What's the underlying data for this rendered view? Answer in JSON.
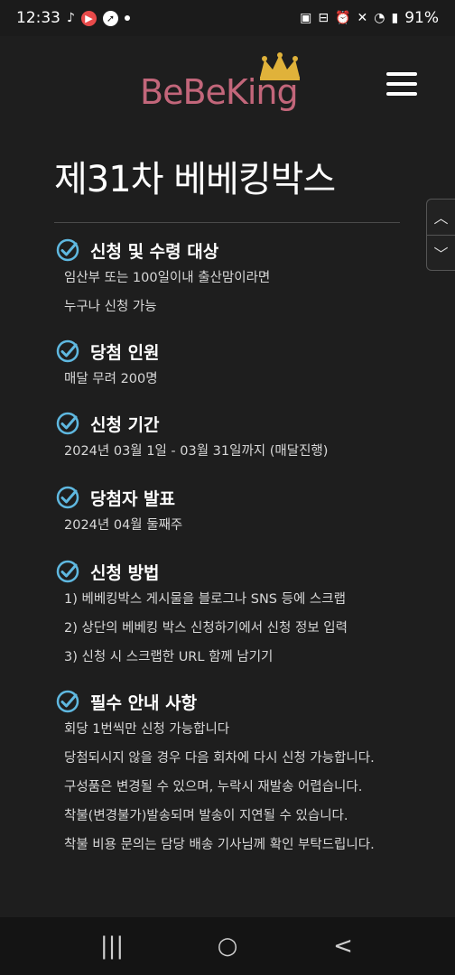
{
  "status": {
    "time": "12:33",
    "battery": "91%"
  },
  "header": {
    "logo_text": "BeBeKing"
  },
  "page": {
    "title": "제31차 베베킹박스"
  },
  "sections": [
    {
      "title": "신청 및 수령 대상",
      "lines": [
        "임산부 또는 100일이내 출산맘이라면",
        "누구나 신청 가능"
      ]
    },
    {
      "title": "당첨 인원",
      "lines": [
        "매달 무려 200명"
      ]
    },
    {
      "title": "신청 기간",
      "lines": [
        "2024년 03월 1일 - 03월 31일까지 (매달진행)"
      ]
    },
    {
      "title": "당첨자 발표",
      "lines": [
        "2024년 04월 둘째주"
      ]
    },
    {
      "title": "신청 방법",
      "lines": [
        "1) 베베킹박스 게시물을 블로그나 SNS 등에 스크랩",
        "2) 상단의 베베킹 박스 신청하기에서 신청 정보 입력",
        "3) 신청 시 스크랩한 URL 함께 남기기"
      ]
    },
    {
      "title": "필수 안내 사항",
      "lines": [
        "회당 1번씩만 신청 가능합니다",
        "당첨되시지 않을 경우 다음 회차에 다시 신청 가능합니다.",
        "구성품은 변경될 수 있으며, 누락시 재발송 어렵습니다.",
        "착불(변경불가)발송되며 발송이 지연될 수 있습니다.",
        "착불 비용 문의는 담당 배송 기사님께 확인 부탁드립니다."
      ]
    }
  ],
  "colors": {
    "accent": "#5fb8e0",
    "logo": "#c2667a",
    "crown": "#e0b23a",
    "background": "#1e1e1e"
  },
  "icons": {
    "check": "check-circle-icon",
    "menu": "hamburger-menu-icon",
    "scroll_up": "chevron-up-icon",
    "scroll_down": "chevron-down-icon",
    "nav_recent": "recent-apps-icon",
    "nav_home": "home-icon",
    "nav_back": "back-icon"
  }
}
